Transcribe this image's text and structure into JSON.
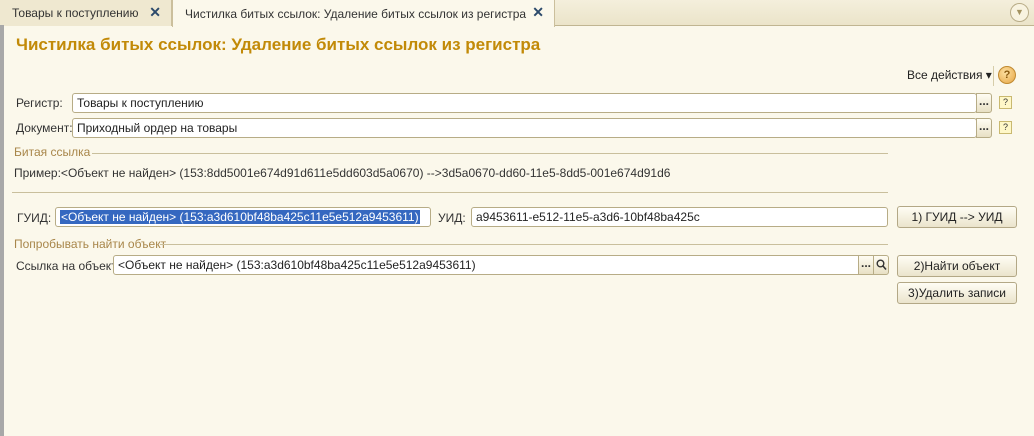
{
  "tabs": [
    {
      "label": "Товары к поступлению",
      "close": "✕"
    },
    {
      "label": "Чистилка битых ссылок: Удаление битых ссылок из регистра",
      "close": "✕"
    }
  ],
  "title": "Чистилка битых ссылок: Удаление битых ссылок из регистра",
  "toolbar": {
    "all_actions": "Все действия ▾",
    "help": "?"
  },
  "register": {
    "label": "Регистр:",
    "value": "Товары к поступлению",
    "dots": "...",
    "hint": "?"
  },
  "document": {
    "label": "Документ:",
    "value": "Приходный ордер на товары",
    "dots": "...",
    "hint": "?"
  },
  "broken_link": {
    "group": "Битая ссылка",
    "example": "Пример:<Объект не найден> (153:8dd5001e674d91d611e5dd603d5a0670)  -->3d5a0670-dd60-11e5-8dd5-001e674d91d6"
  },
  "guid": {
    "label": "ГУИД:",
    "value": "<Объект не найден> (153:a3d610bf48ba425c11e5e512a9453611)"
  },
  "uid": {
    "label": "УИД:",
    "value": "a9453611-e512-11e5-a3d6-10bf48ba425c"
  },
  "find": {
    "group": "Попробывать найти объект",
    "label": "Ссылка на объект:",
    "value": "<Объект не найден> (153:a3d610bf48ba425c11e5e512a9453611)",
    "dots": "..."
  },
  "buttons": {
    "guid_to_uid": "1) ГУИД --> УИД",
    "find_object": "2)Найти объект",
    "delete_records": "3)Удалить записи"
  }
}
